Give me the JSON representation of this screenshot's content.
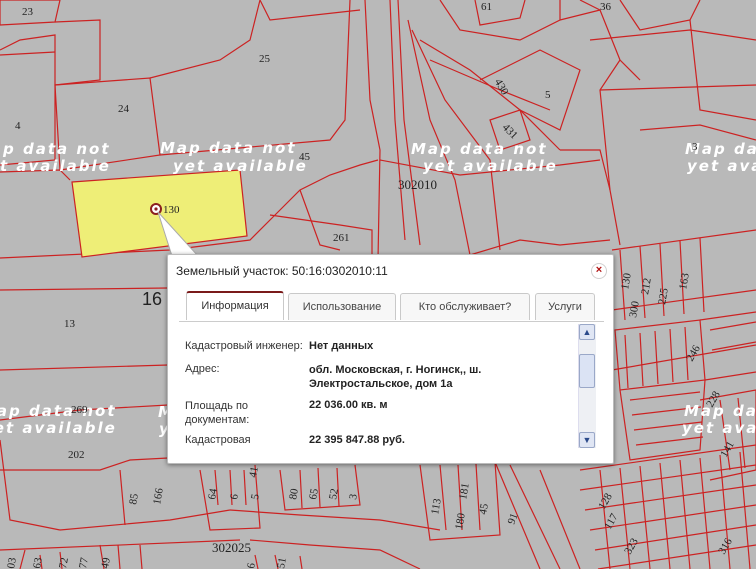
{
  "map": {
    "watermark_line1": "Map data not",
    "watermark_line2": "yet available",
    "zone_labels": [
      "302010",
      "302025"
    ],
    "block_label_16": "16",
    "parcel_numbers": [
      "23",
      "61",
      "36",
      "25",
      "24",
      "4",
      "45",
      "430",
      "5",
      "431",
      "3",
      "261",
      "13",
      "269",
      "202",
      "166",
      "85",
      "64",
      "6",
      "5",
      "80",
      "65",
      "52",
      "3",
      "41",
      "113",
      "180",
      "181",
      "45",
      "91",
      "130",
      "212",
      "225",
      "163",
      "300",
      "246",
      "228",
      "141",
      "128",
      "117",
      "323",
      "316",
      "03",
      "63",
      "72",
      "77",
      "49",
      "6",
      "51"
    ]
  },
  "popup": {
    "title": "Земельный участок: 50:16:0302010:11",
    "close_symbol": "×",
    "tabs": [
      "Информация",
      "Использование",
      "Кто обслуживает?",
      "Услуги"
    ],
    "active_tab": "Информация",
    "rows": [
      {
        "label": "Кадастровый инженер:",
        "value": "Нет данных"
      },
      {
        "label": "Адрес:",
        "value": "обл. Московская, г. Ногинск,, ш. Электростальское, дом 1а"
      },
      {
        "label": "Площадь по документам:",
        "value": "22 036.00 кв. м"
      },
      {
        "label": "Кадастровая",
        "value": "22 395 847.88 руб."
      }
    ]
  },
  "colors": {
    "parcel_line": "#cc2222",
    "selected_fill": "#eeee77",
    "tab_accent": "#7a1a1a"
  }
}
